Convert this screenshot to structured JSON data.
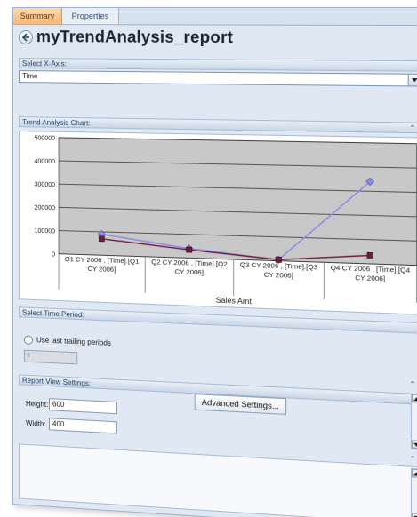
{
  "tabs": [
    {
      "label": "Summary"
    },
    {
      "label": "Properties"
    }
  ],
  "title": "myTrendAnalysis_report",
  "sections": {
    "x_axis": {
      "header": "Select X-Axis:",
      "value": "Time"
    },
    "chart": {
      "header": "Trend Analysis Chart:"
    },
    "time_period": {
      "header": "Select Time Period:",
      "radio_label": "Use last trailing periods",
      "trailing_value": "3"
    },
    "view_settings": {
      "header": "Report View Settings:",
      "advanced_button": "Advanced Settings...",
      "height_label": "Height:",
      "height_value": "600",
      "width_label": "Width:",
      "width_value": "400"
    }
  },
  "icons": {
    "back": "back-arrow-icon",
    "collapse": "double-chevron-up-icon",
    "dropdown": "chevron-down-icon"
  },
  "colors": {
    "panel_bg": "#dfe8f3",
    "plot_bg": "#c8c8c8",
    "series_blue": "#8a8ae8",
    "series_maroon": "#6b1f3c",
    "tab_active": "#f6b97a"
  },
  "chart_data": {
    "type": "line",
    "categories": [
      "Q1 CY 2006 , [Time].[Q1 CY 2006]",
      "Q2 CY 2006 , [Time].[Q2 CY 2006]",
      "Q3 CY 2006 , [Time].[Q3 CY 2006]",
      "Q4 CY 2006 , [Time].[Q4 CY 2006]"
    ],
    "category_lines": [
      [
        "Q1 CY 2006 , [Time].[Q1",
        "CY 2006]"
      ],
      [
        "Q2 CY 2006 , [Time].[Q2",
        "CY 2006]"
      ],
      [
        "Q3 CY 2006 , [Time].[Q3",
        "CY 2006]"
      ],
      [
        "Q4 CY 2006 , [Time].[Q4",
        "CY 2006]"
      ]
    ],
    "series": [
      {
        "values": [
          90000,
          40000,
          5000,
          340000
        ],
        "color": "#8a8ae8",
        "marker": "diamond"
      },
      {
        "values": [
          70000,
          35000,
          5000,
          35000
        ],
        "color": "#6b1f3c",
        "marker": "square"
      }
    ],
    "xlabel": "Sales Amt",
    "ylabel": "",
    "ylim": [
      0,
      500000
    ],
    "yticks": [
      0,
      100000,
      200000,
      300000,
      400000,
      500000
    ],
    "grid": true
  }
}
